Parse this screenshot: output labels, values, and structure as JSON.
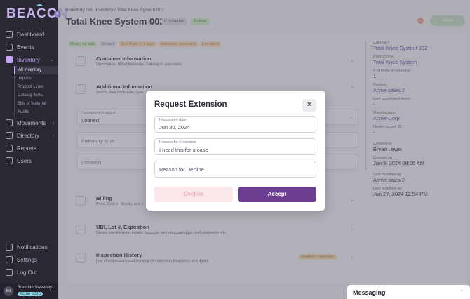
{
  "brand": {
    "logo": "BEACON",
    "badge": "«"
  },
  "nav": {
    "items": [
      {
        "label": "Dashboard"
      },
      {
        "label": "Events"
      },
      {
        "label": "Inventory",
        "chev": "⌄"
      },
      {
        "label": "Movements",
        "chev": "›"
      },
      {
        "label": "Directory",
        "chev": "›"
      },
      {
        "label": "Reports"
      },
      {
        "label": "Users"
      }
    ],
    "inventory_sub": [
      "All Inventory",
      "Imports",
      "Product Lines",
      "Catalog Items",
      "Bills of Material",
      "Audits"
    ],
    "bottom": [
      {
        "label": "Notifications"
      },
      {
        "label": "Settings"
      },
      {
        "label": "Log Out"
      }
    ]
  },
  "user": {
    "initials": "BS",
    "name": "Brendan Sweeney",
    "org": "Acme Corp"
  },
  "header": {
    "breadcrumb": "Inventory / All Inventory / Total Knee System 002",
    "title": "Total Knee System 002",
    "tags": [
      "Container",
      "Active"
    ],
    "save_label": "Save"
  },
  "chips": [
    {
      "label": "Ready for sale",
      "kind": "green"
    },
    {
      "label": "Unused",
      "kind": "grey"
    },
    {
      "label": "Due Back in 1 days",
      "kind": "orange"
    },
    {
      "label": "Extension requested",
      "kind": "orange"
    },
    {
      "label": "Low stock",
      "kind": "orange"
    }
  ],
  "sections": {
    "container": {
      "title": "Container Information",
      "desc": "Description, Bill of Materials, Catalog #, and notes",
      "chev": "⌄"
    },
    "additional": {
      "title": "Additional Information",
      "desc": "Status, Due back date, type",
      "chev": "⌃"
    },
    "billing": {
      "title": "Billing",
      "desc": "Price, Cost of Goods, and c",
      "chev": "⌄"
    },
    "udi": {
      "title": "UDI, Lot #, Expiration",
      "desc": "Device identification details, barcode, manufacturer date, and expiration info",
      "chev": "⌄"
    },
    "inspection": {
      "title": "Inspection History",
      "desc": "Log of inspections and tracking of inspection frequency and dates",
      "badge": "Requires inspection",
      "chev": "⌄"
    }
  },
  "fields": {
    "consignment": {
      "label": "Consignment status",
      "value": "Loaned",
      "chev": "⌄"
    },
    "inventory_type": {
      "placeholder": "Inventory type"
    },
    "location": {
      "placeholder": "Location"
    }
  },
  "details": [
    {
      "label": "Catalog #",
      "value": "Total Knee System 002",
      "link": true
    },
    {
      "label": "Product line",
      "value": "Total Knee System",
      "link": true
    },
    {
      "label": "# of items in container",
      "value": "1",
      "link": false
    },
    {
      "label": "Custody",
      "value": "Acme sales 2",
      "link": true
    },
    {
      "label": "Last associated event",
      "value": "-",
      "link": false
    },
    {
      "label": "Manufacturer",
      "value": "Acme Corp",
      "link": true
    },
    {
      "label": "Health record ID",
      "value": "-",
      "link": false
    },
    {
      "label": "Created by",
      "value": "Bryan Lewis",
      "link": false
    },
    {
      "label": "Created on",
      "value": "Jan 9, 2024 08:05 AM",
      "link": false
    },
    {
      "label": "Last modified by",
      "value": "Acme sales 2",
      "link": false
    },
    {
      "label": "Last modified on",
      "value": "Jun 27, 2024 12:54 PM",
      "link": false
    }
  ],
  "modal": {
    "title": "Request Extension",
    "close": "✕",
    "requested_date": {
      "label": "Requested date",
      "value": "Jun 30, 2024"
    },
    "reason_extension": {
      "label": "Reason for Extension",
      "value": "I need this for a case"
    },
    "reason_decline": {
      "placeholder": "Reason for Decline",
      "value": ""
    },
    "decline_label": "Decline",
    "accept_label": "Accept"
  },
  "messaging": {
    "title": "Messaging",
    "chev": "⌃"
  },
  "colors": {
    "accent": "#6b3e91",
    "sidebar": "#2a2833",
    "active_nav": "#c6a8f3"
  }
}
